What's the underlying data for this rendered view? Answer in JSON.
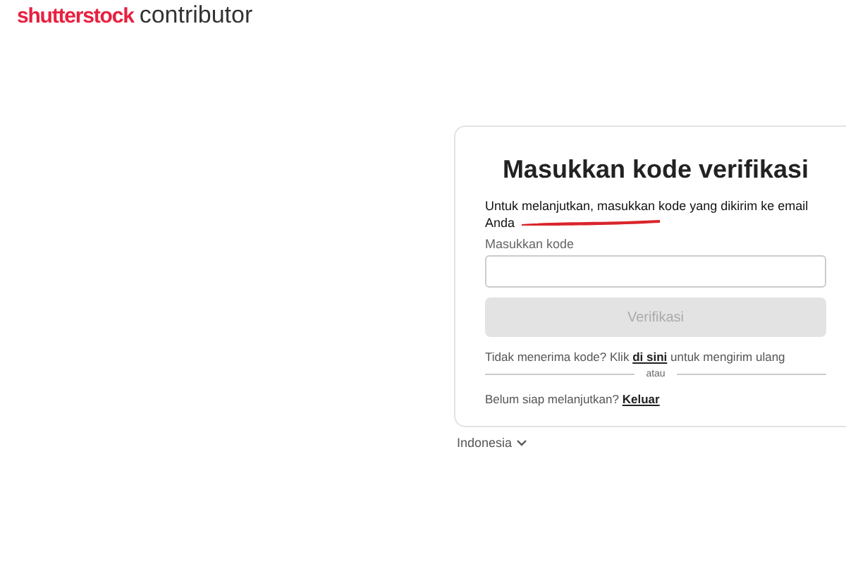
{
  "logo": {
    "brand": "shutterstock",
    "product": "contributor"
  },
  "card": {
    "title": "Masukkan kode verifikasi",
    "description": "Untuk melanjutkan, masukkan kode yang dikirim ke email Anda",
    "email_redacted": true,
    "field": {
      "label": "Masukkan kode"
    },
    "button": {
      "label": "Verifikasi",
      "disabled": true
    },
    "resend": {
      "before": "Tidak menerima kode? Klik",
      "link": "di sini",
      "after": "untuk mengirim ulang"
    },
    "divider": "atau",
    "exit": {
      "before": "Belum siap melanjutkan?",
      "link": "Keluar"
    }
  },
  "language": {
    "label": "Indonesia"
  }
}
